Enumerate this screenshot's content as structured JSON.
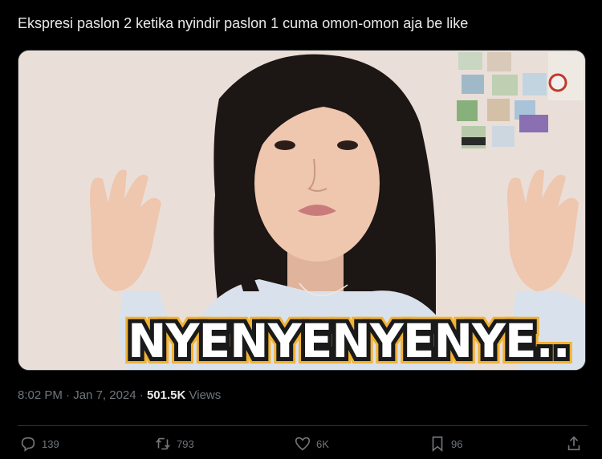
{
  "tweet": {
    "text": "Ekspresi paslon 2 ketika nyindir paslon 1 cuma omon-omon aja be like"
  },
  "media": {
    "caption": "NYENYENYENYE.."
  },
  "meta": {
    "time": "8:02 PM",
    "separator1": " · ",
    "date": "Jan 7, 2024",
    "separator2": " · ",
    "views_count": "501.5K",
    "views_label": " Views"
  },
  "actions": {
    "replies": "139",
    "reposts": "793",
    "likes": "6K",
    "bookmarks": "96"
  },
  "colors": {
    "background": "#000000",
    "text": "#e7e9ea",
    "muted": "#71767b",
    "caption_outline": "#f2b233"
  }
}
